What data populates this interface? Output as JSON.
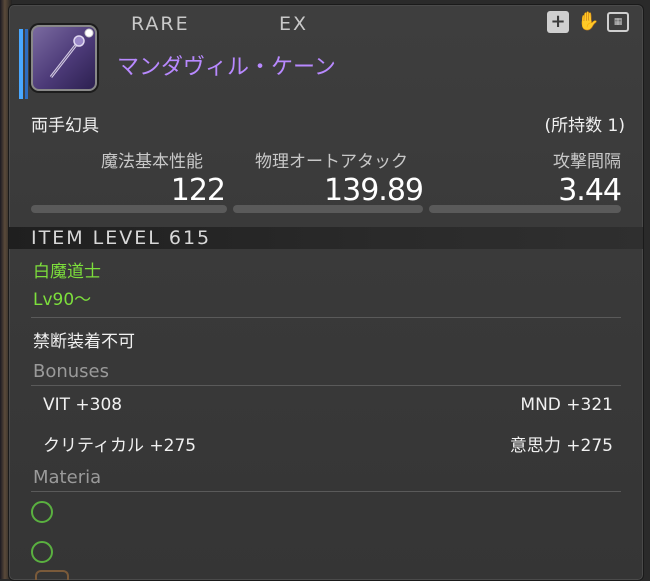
{
  "header": {
    "rarity": "RARE",
    "tradability": "EX",
    "icons": [
      "plus-icon",
      "hand-icon",
      "storage-icon"
    ]
  },
  "item": {
    "name": "マンダヴィル・ケーン",
    "type": "両手幻具",
    "owned": "(所持数 1)",
    "icon": "staff-icon"
  },
  "stats": [
    {
      "label": "魔法基本性能",
      "value": "122"
    },
    {
      "label": "物理オートアタック",
      "value": "139.89"
    },
    {
      "label": "攻撃間隔",
      "value": "3.44"
    }
  ],
  "item_level": "ITEM LEVEL 615",
  "job": "白魔道士",
  "level_req": "Lv90～",
  "restriction": "禁断装着不可",
  "bonuses": {
    "title": "Bonuses",
    "items": [
      {
        "left": "VIT +308",
        "right": "MND +321"
      },
      {
        "left": "クリティカル +275",
        "right": "意思力 +275"
      }
    ]
  },
  "materia": {
    "title": "Materia",
    "slots": [
      "empty",
      "empty"
    ]
  },
  "colors": {
    "item_name": "#b889ff",
    "job_text": "#7ddf3c",
    "materia_ring": "#5ab040",
    "accent_bar": "#4aa8ff"
  }
}
